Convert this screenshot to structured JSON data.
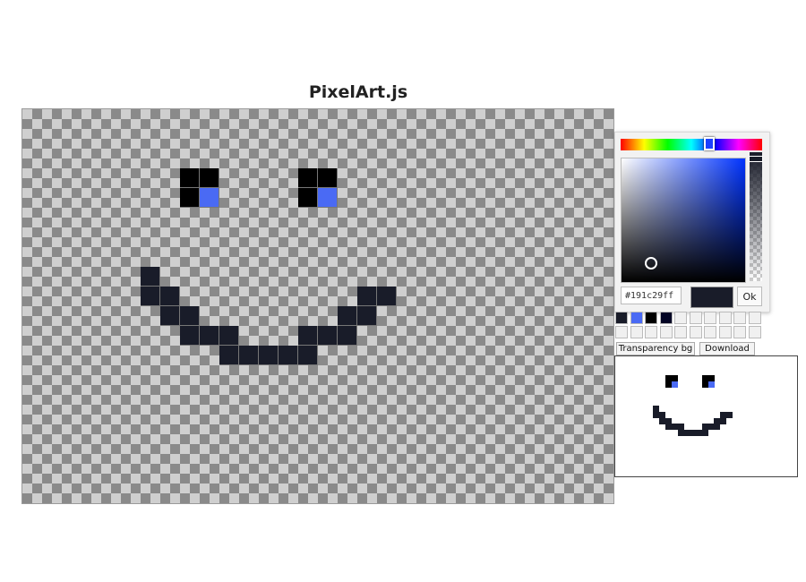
{
  "title": "PixelArt.js",
  "colors": {
    "dark": "#191c29",
    "black": "#000000",
    "blue": "#4a6af4",
    "navy": "#020424"
  },
  "canvas": {
    "cell_size": "22px",
    "grid": {
      "cols": 30,
      "rows": 20
    },
    "pixels": [
      {
        "c": 8,
        "r": 3,
        "color": "black"
      },
      {
        "c": 9,
        "r": 3,
        "color": "black"
      },
      {
        "c": 8,
        "r": 4,
        "color": "black"
      },
      {
        "c": 9,
        "r": 4,
        "color": "blue"
      },
      {
        "c": 14,
        "r": 3,
        "color": "black"
      },
      {
        "c": 15,
        "r": 3,
        "color": "black"
      },
      {
        "c": 14,
        "r": 4,
        "color": "black"
      },
      {
        "c": 15,
        "r": 4,
        "color": "blue"
      },
      {
        "c": 6,
        "r": 8,
        "color": "dark"
      },
      {
        "c": 6,
        "r": 9,
        "color": "dark"
      },
      {
        "c": 7,
        "r": 9,
        "color": "dark"
      },
      {
        "c": 7,
        "r": 10,
        "color": "dark"
      },
      {
        "c": 8,
        "r": 10,
        "color": "dark"
      },
      {
        "c": 8,
        "r": 11,
        "color": "dark"
      },
      {
        "c": 9,
        "r": 11,
        "color": "dark"
      },
      {
        "c": 10,
        "r": 11,
        "color": "dark"
      },
      {
        "c": 10,
        "r": 12,
        "color": "dark"
      },
      {
        "c": 11,
        "r": 12,
        "color": "dark"
      },
      {
        "c": 12,
        "r": 12,
        "color": "dark"
      },
      {
        "c": 13,
        "r": 12,
        "color": "dark"
      },
      {
        "c": 14,
        "r": 12,
        "color": "dark"
      },
      {
        "c": 14,
        "r": 11,
        "color": "dark"
      },
      {
        "c": 15,
        "r": 11,
        "color": "dark"
      },
      {
        "c": 16,
        "r": 11,
        "color": "dark"
      },
      {
        "c": 16,
        "r": 10,
        "color": "dark"
      },
      {
        "c": 17,
        "r": 10,
        "color": "dark"
      },
      {
        "c": 17,
        "r": 9,
        "color": "dark"
      },
      {
        "c": 18,
        "r": 9,
        "color": "dark"
      }
    ]
  },
  "color_picker": {
    "hex_value": "#191c29ff",
    "ok_label": "Ok"
  },
  "palette": {
    "swatches": [
      "#191c29",
      "#4a6af4",
      "#000000",
      "#020424",
      "",
      "",
      "",
      "",
      "",
      "",
      "",
      "",
      "",
      "",
      "",
      "",
      "",
      "",
      "",
      ""
    ]
  },
  "buttons": {
    "transparency_label": "Transparency bg",
    "download_label": "Download"
  }
}
